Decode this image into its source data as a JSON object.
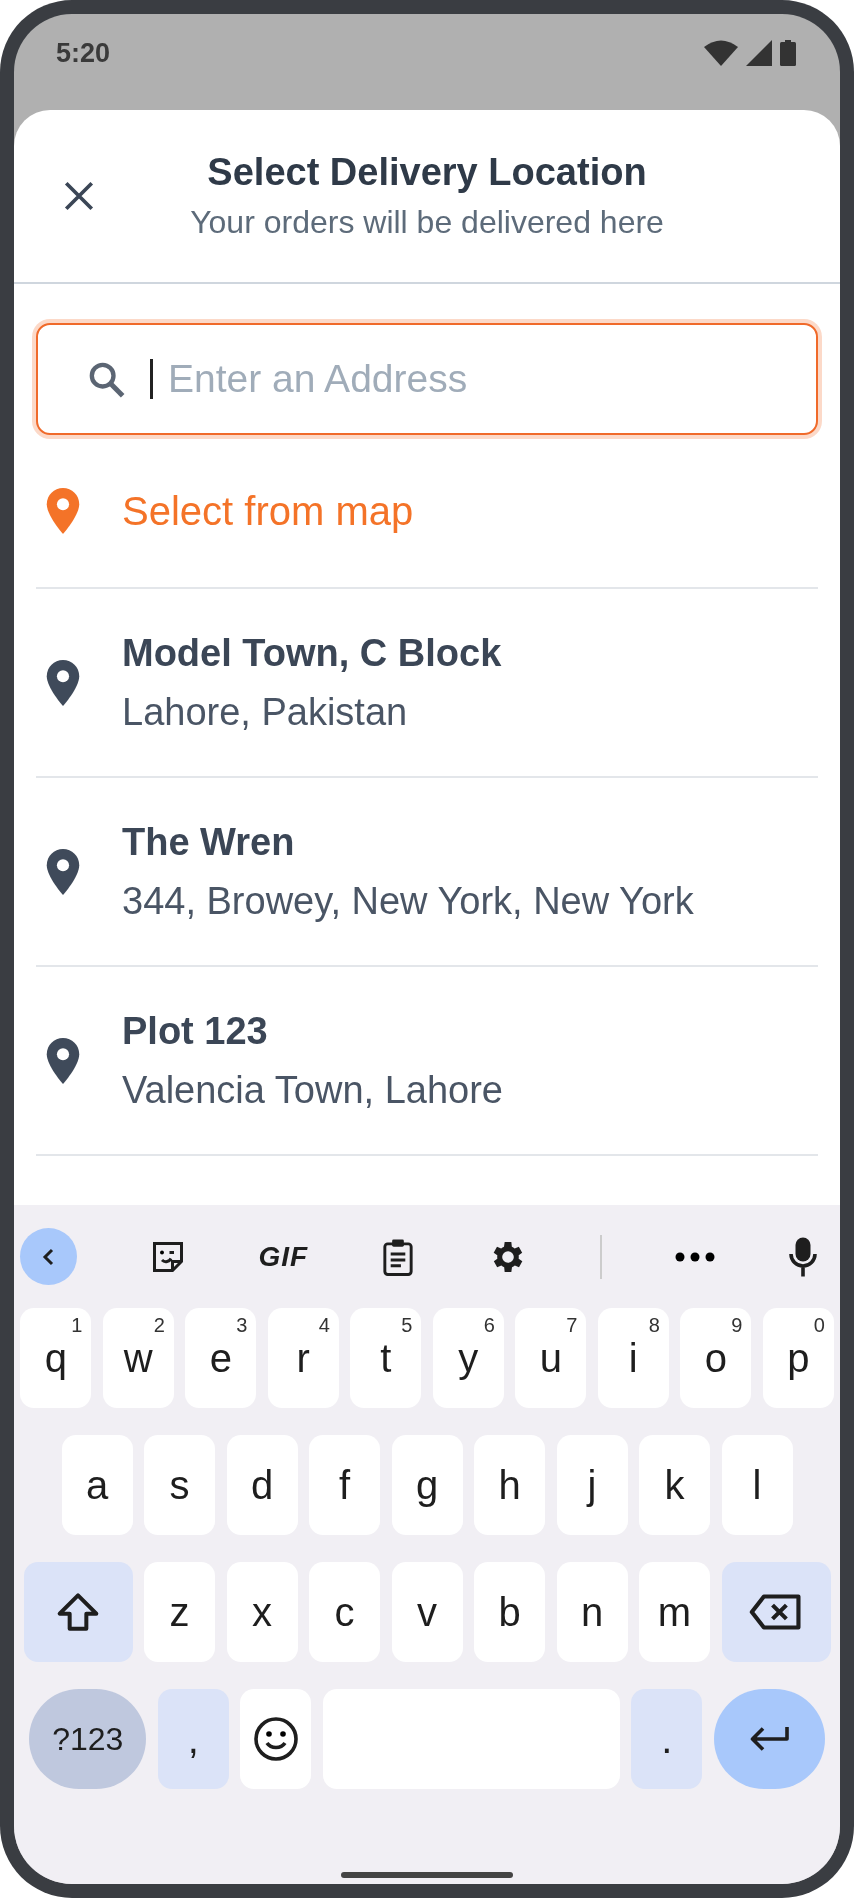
{
  "status_bar": {
    "time": "5:20"
  },
  "sheet": {
    "title": "Select Delivery Location",
    "subtitle": "Your orders will be delivered here",
    "search": {
      "placeholder": "Enter an Address"
    },
    "map_option": {
      "label": "Select from map"
    },
    "addresses": [
      {
        "name": "Model Town, C Block",
        "detail": "Lahore, Pakistan"
      },
      {
        "name": "The Wren",
        "detail": "344, Browey, New York, New York"
      },
      {
        "name": "Plot 123",
        "detail": "Valencia Town, Lahore"
      }
    ]
  },
  "keyboard": {
    "toolbar": [
      {
        "kind": "back"
      },
      {
        "kind": "sticker"
      },
      {
        "kind": "gif",
        "label": "GIF"
      },
      {
        "kind": "clipboard"
      },
      {
        "kind": "settings"
      },
      {
        "kind": "divider"
      },
      {
        "kind": "more"
      },
      {
        "kind": "mic"
      }
    ],
    "rows": [
      [
        {
          "kind": "letter",
          "label": "q",
          "hint": "1"
        },
        {
          "kind": "letter",
          "label": "w",
          "hint": "2"
        },
        {
          "kind": "letter",
          "label": "e",
          "hint": "3"
        },
        {
          "kind": "letter",
          "label": "r",
          "hint": "4"
        },
        {
          "kind": "letter",
          "label": "t",
          "hint": "5"
        },
        {
          "kind": "letter",
          "label": "y",
          "hint": "6"
        },
        {
          "kind": "letter",
          "label": "u",
          "hint": "7"
        },
        {
          "kind": "letter",
          "label": "i",
          "hint": "8"
        },
        {
          "kind": "letter",
          "label": "o",
          "hint": "9"
        },
        {
          "kind": "letter",
          "label": "p",
          "hint": "0"
        }
      ],
      [
        {
          "kind": "letter",
          "label": "a"
        },
        {
          "kind": "letter",
          "label": "s"
        },
        {
          "kind": "letter",
          "label": "d"
        },
        {
          "kind": "letter",
          "label": "f"
        },
        {
          "kind": "letter",
          "label": "g"
        },
        {
          "kind": "letter",
          "label": "h"
        },
        {
          "kind": "letter",
          "label": "j"
        },
        {
          "kind": "letter",
          "label": "k"
        },
        {
          "kind": "letter",
          "label": "l"
        }
      ],
      [
        {
          "kind": "shift"
        },
        {
          "kind": "letter",
          "label": "z"
        },
        {
          "kind": "letter",
          "label": "x"
        },
        {
          "kind": "letter",
          "label": "c"
        },
        {
          "kind": "letter",
          "label": "v"
        },
        {
          "kind": "letter",
          "label": "b"
        },
        {
          "kind": "letter",
          "label": "n"
        },
        {
          "kind": "letter",
          "label": "m"
        },
        {
          "kind": "backspace"
        }
      ],
      [
        {
          "kind": "symbols",
          "label": "?123"
        },
        {
          "kind": "punct",
          "label": ","
        },
        {
          "kind": "emoji"
        },
        {
          "kind": "space"
        },
        {
          "kind": "punct",
          "label": "."
        },
        {
          "kind": "enter"
        }
      ]
    ]
  }
}
